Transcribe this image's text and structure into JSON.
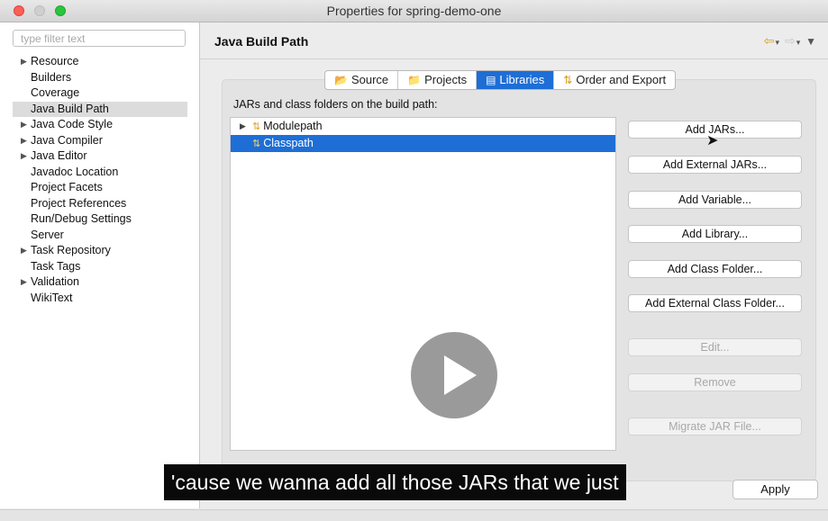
{
  "window": {
    "title": "Properties for spring-demo-one"
  },
  "sidebar": {
    "filter_placeholder": "type filter text",
    "items": [
      {
        "label": "Resource",
        "expandable": true
      },
      {
        "label": "Builders",
        "expandable": false
      },
      {
        "label": "Coverage",
        "expandable": false
      },
      {
        "label": "Java Build Path",
        "expandable": false,
        "selected": true
      },
      {
        "label": "Java Code Style",
        "expandable": true
      },
      {
        "label": "Java Compiler",
        "expandable": true
      },
      {
        "label": "Java Editor",
        "expandable": true
      },
      {
        "label": "Javadoc Location",
        "expandable": false
      },
      {
        "label": "Project Facets",
        "expandable": false
      },
      {
        "label": "Project References",
        "expandable": false
      },
      {
        "label": "Run/Debug Settings",
        "expandable": false
      },
      {
        "label": "Server",
        "expandable": false
      },
      {
        "label": "Task Repository",
        "expandable": true
      },
      {
        "label": "Task Tags",
        "expandable": false
      },
      {
        "label": "Validation",
        "expandable": true
      },
      {
        "label": "WikiText",
        "expandable": false
      }
    ]
  },
  "main": {
    "title": "Java Build Path",
    "tabs": [
      {
        "label": "Source",
        "icon": "source-folder-icon"
      },
      {
        "label": "Projects",
        "icon": "projects-folder-icon"
      },
      {
        "label": "Libraries",
        "icon": "libraries-icon",
        "active": true
      },
      {
        "label": "Order and Export",
        "icon": "order-export-icon"
      }
    ],
    "panel_label": "JARs and class folders on the build path:",
    "tree": [
      {
        "label": "Modulepath",
        "expandable": true,
        "selected": false
      },
      {
        "label": "Classpath",
        "expandable": false,
        "selected": true
      }
    ],
    "buttons": [
      {
        "label": "Add JARs...",
        "enabled": true
      },
      {
        "label": "Add External JARs...",
        "enabled": true
      },
      {
        "label": "Add Variable...",
        "enabled": true
      },
      {
        "label": "Add Library...",
        "enabled": true
      },
      {
        "label": "Add Class Folder...",
        "enabled": true
      },
      {
        "label": "Add External Class Folder...",
        "enabled": true
      },
      {
        "label": "Edit...",
        "enabled": false
      },
      {
        "label": "Remove",
        "enabled": false
      },
      {
        "label": "Migrate JAR File...",
        "enabled": false
      }
    ]
  },
  "footer": {
    "apply_label": "Apply"
  },
  "video": {
    "caption": "'cause we wanna add all those JARs that we just"
  },
  "colors": {
    "accent": "#1e6ed6",
    "caption_bg": "#0a0a0a"
  }
}
